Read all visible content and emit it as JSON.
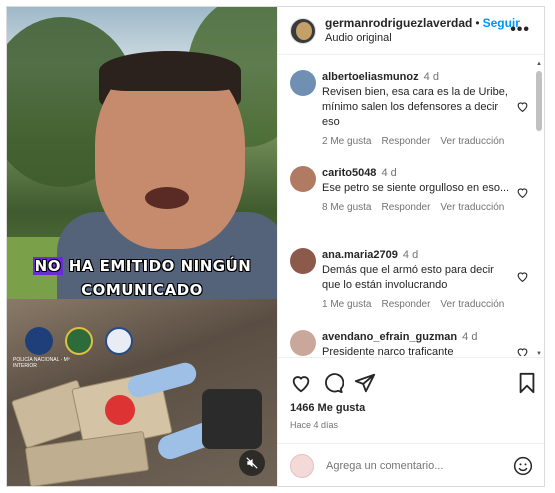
{
  "post": {
    "username": "germanrodriguezlaverdad",
    "follow_label": "Seguir",
    "audio": "Audio original",
    "more_icon": "more-horizontal-icon"
  },
  "media": {
    "caption_line1_prefix": "NO",
    "caption_line1_rest": " HA EMITIDO NINGÚN",
    "caption_line2": "COMUNICADO",
    "badge_text": "POLICÍA NACIONAL · Mº INTERIOR",
    "mute_icon": "speaker-muted-icon"
  },
  "comments": [
    {
      "user": "albertoeliasmunoz",
      "time": "4 d",
      "text": "Revisen bien, esa cara es la de Uribe, mínimo salen los defensores a decir eso",
      "likes": "2 Me gusta",
      "reply": "Responder",
      "translate": "Ver traducción",
      "avatar_color": "#6f8fb3"
    },
    {
      "user": "carito5048",
      "time": "4 d",
      "text": "Ese petro se siente orgulloso en eso...",
      "likes": "8 Me gusta",
      "reply": "Responder",
      "translate": "Ver traducción",
      "avatar_color": "#b07a63"
    },
    {
      "user": "ana.maria2709",
      "time": "4 d",
      "text": "Demás que el armó esto para decir que lo están involucrando",
      "likes": "1 Me gusta",
      "reply": "Responder",
      "translate": "Ver traducción",
      "avatar_color": "#8c5a4a"
    },
    {
      "user": "avendano_efrain_guzman",
      "time": "4 d",
      "text": "Presidente narco traficante",
      "avatar_color": "#c9a79a"
    }
  ],
  "actions": {
    "like_icon": "heart-icon",
    "comment_icon": "comment-icon",
    "share_icon": "send-icon",
    "save_icon": "bookmark-icon",
    "likes_count": "1466 Me gusta",
    "posted": "Hace 4 días"
  },
  "add_comment": {
    "placeholder": "Agrega un comentario...",
    "emoji_icon": "emoji-icon"
  }
}
